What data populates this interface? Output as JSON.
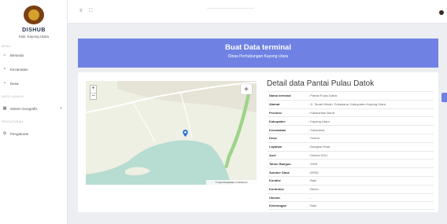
{
  "sidebar": {
    "brand": "DISHUB",
    "subtitle": "Kab. Kayong Utara",
    "section_main": "MENU",
    "section_data": "DATA LAINNYA",
    "section_settings": "PENGATURAN",
    "items": [
      {
        "label": "Beranda",
        "icon": "home-icon"
      },
      {
        "label": "Kecamatan",
        "icon": "map-pin-icon"
      },
      {
        "label": "Desa",
        "icon": "map-pin-icon"
      },
      {
        "label": "Sistem Geografis",
        "icon": "map-icon",
        "has_submenu": true
      },
      {
        "label": "Pengaturan",
        "icon": "settings-icon"
      }
    ]
  },
  "topbar": {
    "menu_icon": "≡",
    "fullscreen_icon": "⛶"
  },
  "banner": {
    "title": "Buat Data terminal",
    "subtitle": "Dinas Perhubungan Kayong Utara",
    "color": "#6f82e3"
  },
  "map": {
    "zoom_in": "+",
    "zoom_out": "−",
    "attribution": "© OpenStreetMap contributors"
  },
  "detail": {
    "title": "Detail data Pantai Pulau Datok",
    "rows": [
      {
        "key": "Nama terminal",
        "value": ": Pantai Pulau Datok"
      },
      {
        "key": "Alamat",
        "value": ": Jl. Tanah Merah, Sukadana, Kabupaten Kayong Utara"
      },
      {
        "key": "Provinsi",
        "value": ": Kalimantan Barat"
      },
      {
        "key": "Kabupaten",
        "value": ": Kayong Utara"
      },
      {
        "key": "Kecamatan",
        "value": ": Sukadana"
      },
      {
        "key": "Desa",
        "value": ": Sutera"
      },
      {
        "key": "Layanan",
        "value": ": Bongkar Muat"
      },
      {
        "key": "Aset",
        "value": ": Dishub KKU"
      },
      {
        "key": "Tahun Bangun",
        "value": ": 2009"
      },
      {
        "key": "Sumber Dana",
        "value": ": APBD"
      },
      {
        "key": "Kondisi",
        "value": ": Baik"
      },
      {
        "key": "Kontruksi",
        "value": ": Beton"
      },
      {
        "key": "Ukuran",
        "value": ": -"
      },
      {
        "key": "Keterangan",
        "value": ": Baik"
      }
    ]
  }
}
